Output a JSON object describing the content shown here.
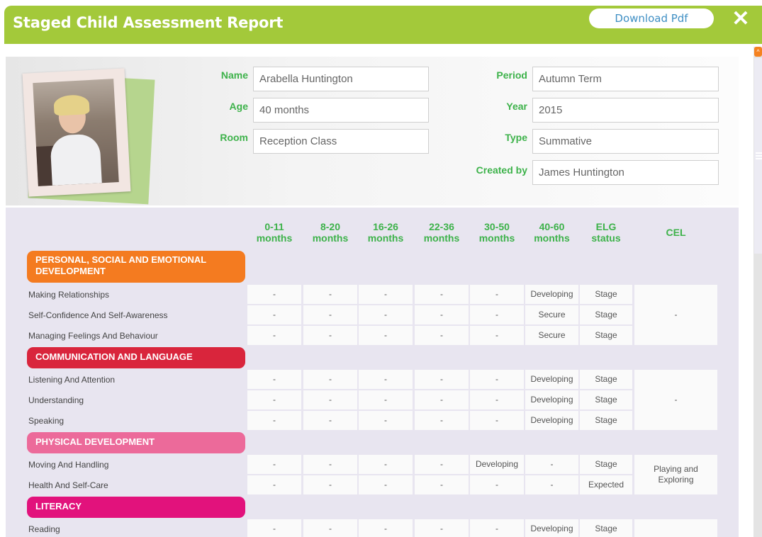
{
  "header": {
    "title": "Staged Child Assessment Report",
    "download_label": "Download Pdf",
    "close_icon": "close-icon",
    "colors": {
      "header_green": "#a3c93a",
      "label_green": "#3db24a",
      "link_blue": "#3f8fc4"
    }
  },
  "profile": {
    "photo_alt": "child-photo",
    "name_label": "Name",
    "name_value": "Arabella Huntington",
    "age_label": "Age",
    "age_value": "40 months",
    "room_label": "Room",
    "room_value": "Reception Class",
    "period_label": "Period",
    "period_value": "Autumn Term",
    "year_label": "Year",
    "year_value": "2015",
    "type_label": "Type",
    "type_value": "Summative",
    "created_label": "Created by",
    "created_value": "James Huntington"
  },
  "table": {
    "columns": [
      [
        "0-11",
        "months"
      ],
      [
        "8-20",
        "months"
      ],
      [
        "16-26",
        "months"
      ],
      [
        "22-36",
        "months"
      ],
      [
        "30-50",
        "months"
      ],
      [
        "40-60",
        "months"
      ],
      [
        "ELG",
        "status"
      ]
    ],
    "cel_header": "CEL",
    "sections": [
      {
        "title_lines": [
          "PERSONAL, SOCIAL AND EMOTIONAL",
          "DEVELOPMENT"
        ],
        "color": "#f47b20",
        "rows": [
          {
            "label": "Making Relationships",
            "cells": [
              "-",
              "-",
              "-",
              "-",
              "-",
              "Developing",
              "Stage"
            ]
          },
          {
            "label": "Self-Confidence And Self-Awareness",
            "cells": [
              "-",
              "-",
              "-",
              "-",
              "-",
              "Secure",
              "Stage"
            ]
          },
          {
            "label": "Managing Feelings And Behaviour",
            "cells": [
              "-",
              "-",
              "-",
              "-",
              "-",
              "Secure",
              "Stage"
            ]
          }
        ],
        "cel_lines": [
          "-"
        ]
      },
      {
        "title_lines": [
          "COMMUNICATION AND LANGUAGE"
        ],
        "color": "#d9253c",
        "rows": [
          {
            "label": "Listening And Attention",
            "cells": [
              "-",
              "-",
              "-",
              "-",
              "-",
              "Developing",
              "Stage"
            ]
          },
          {
            "label": "Understanding",
            "cells": [
              "-",
              "-",
              "-",
              "-",
              "-",
              "Developing",
              "Stage"
            ]
          },
          {
            "label": "Speaking",
            "cells": [
              "-",
              "-",
              "-",
              "-",
              "-",
              "Developing",
              "Stage"
            ]
          }
        ],
        "cel_lines": [
          "-"
        ]
      },
      {
        "title_lines": [
          "PHYSICAL DEVELOPMENT"
        ],
        "color": "#ec6a9a",
        "rows": [
          {
            "label": "Moving And Handling",
            "cells": [
              "-",
              "-",
              "-",
              "-",
              "Developing",
              "-",
              "Stage"
            ]
          },
          {
            "label": "Health And Self-Care",
            "cells": [
              "-",
              "-",
              "-",
              "-",
              "-",
              "-",
              "Expected"
            ]
          }
        ],
        "cel_lines": [
          "Playing and",
          "Exploring"
        ]
      },
      {
        "title_lines": [
          "LITERACY"
        ],
        "color": "#e2127c",
        "rows": [
          {
            "label": "Reading",
            "cells": [
              "-",
              "-",
              "-",
              "-",
              "-",
              "Developing",
              "Stage"
            ]
          }
        ],
        "cel_lines": []
      }
    ]
  }
}
